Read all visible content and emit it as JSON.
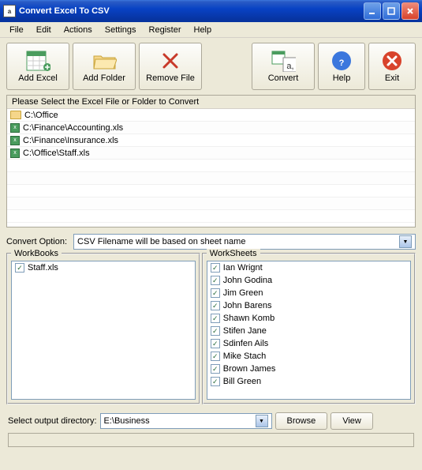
{
  "window": {
    "title": "Convert Excel To CSV"
  },
  "menu": {
    "file": "File",
    "edit": "Edit",
    "actions": "Actions",
    "settings": "Settings",
    "register": "Register",
    "help": "Help"
  },
  "toolbar": {
    "add_excel": "Add Excel",
    "add_folder": "Add Folder",
    "remove_file": "Remove File",
    "convert": "Convert",
    "help": "Help",
    "exit": "Exit"
  },
  "filelist": {
    "header": "Please Select the Excel File or Folder to Convert",
    "items": [
      {
        "type": "folder",
        "path": "C:\\Office"
      },
      {
        "type": "xls",
        "path": "C:\\Finance\\Accounting.xls"
      },
      {
        "type": "xls",
        "path": "C:\\Finance\\Insurance.xls"
      },
      {
        "type": "xls",
        "path": "C:\\Office\\Staff.xls"
      }
    ]
  },
  "convert_option": {
    "label": "Convert Option:",
    "selected": "CSV Filename will be based on sheet name"
  },
  "workbooks": {
    "title": "WorkBooks",
    "items": [
      {
        "checked": true,
        "name": "Staff.xls"
      }
    ]
  },
  "worksheets": {
    "title": "WorkSheets",
    "items": [
      {
        "checked": true,
        "name": "Ian Wrignt"
      },
      {
        "checked": true,
        "name": "John Godina"
      },
      {
        "checked": true,
        "name": "Jim Green"
      },
      {
        "checked": true,
        "name": "John Barens"
      },
      {
        "checked": true,
        "name": "Shawn Komb"
      },
      {
        "checked": true,
        "name": "Stifen Jane"
      },
      {
        "checked": true,
        "name": "Sdinfen Ails"
      },
      {
        "checked": true,
        "name": "Mike Stach"
      },
      {
        "checked": true,
        "name": "Brown James"
      },
      {
        "checked": true,
        "name": "Bill Green"
      }
    ]
  },
  "output": {
    "label": "Select  output directory:",
    "selected": "E:\\Business",
    "browse": "Browse",
    "view": "View"
  }
}
